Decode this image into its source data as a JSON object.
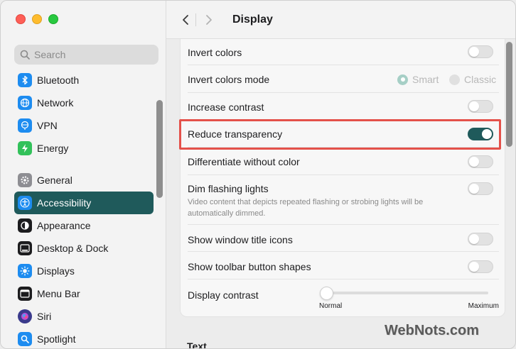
{
  "header": {
    "title": "Display"
  },
  "search": {
    "placeholder": "Search"
  },
  "sidebar": {
    "items": [
      {
        "label": "Bluetooth",
        "icon": "bluetooth-icon",
        "color": "#1d8cf0"
      },
      {
        "label": "Network",
        "icon": "globe-icon",
        "color": "#1d8cf0"
      },
      {
        "label": "VPN",
        "icon": "vpn-icon",
        "color": "#1d8cf0"
      },
      {
        "label": "Energy",
        "icon": "energy-icon",
        "color": "#32c15a"
      },
      {
        "label": "General",
        "icon": "gear-icon",
        "color": "#8e8e93"
      },
      {
        "label": "Accessibility",
        "icon": "accessibility-icon",
        "color": "#1d8cf0",
        "active": true
      },
      {
        "label": "Appearance",
        "icon": "appearance-icon",
        "color": "#1c1c1e"
      },
      {
        "label": "Desktop & Dock",
        "icon": "dock-icon",
        "color": "#1c1c1e"
      },
      {
        "label": "Displays",
        "icon": "sun-icon",
        "color": "#1d8cf0"
      },
      {
        "label": "Menu Bar",
        "icon": "menu-bar-icon",
        "color": "#1c1c1e"
      },
      {
        "label": "Siri",
        "icon": "siri-icon",
        "color": "#3a3a8c"
      },
      {
        "label": "Spotlight",
        "icon": "spotlight-icon",
        "color": "#1d8cf0"
      }
    ]
  },
  "settings": {
    "invert_colors": {
      "label": "Invert colors",
      "on": false
    },
    "invert_colors_mode": {
      "label": "Invert colors mode",
      "options": [
        "Smart",
        "Classic"
      ],
      "selected": "Smart"
    },
    "increase_contrast": {
      "label": "Increase contrast",
      "on": false
    },
    "reduce_transparency": {
      "label": "Reduce transparency",
      "on": true
    },
    "differentiate_without_color": {
      "label": "Differentiate without color",
      "on": false
    },
    "dim_flashing_lights": {
      "label": "Dim flashing lights",
      "description": "Video content that depicts repeated flashing or strobing lights will be automatically dimmed.",
      "on": false
    },
    "show_window_title_icons": {
      "label": "Show window title icons",
      "on": false
    },
    "show_toolbar_button_shapes": {
      "label": "Show toolbar button shapes",
      "on": false
    },
    "display_contrast": {
      "label": "Display contrast",
      "min_label": "Normal",
      "max_label": "Maximum",
      "value": 0
    }
  },
  "sections": {
    "text": "Text"
  },
  "watermark": "WebNots.com",
  "colors": {
    "accent": "#1f5a5b",
    "highlight": "#e4514a"
  }
}
